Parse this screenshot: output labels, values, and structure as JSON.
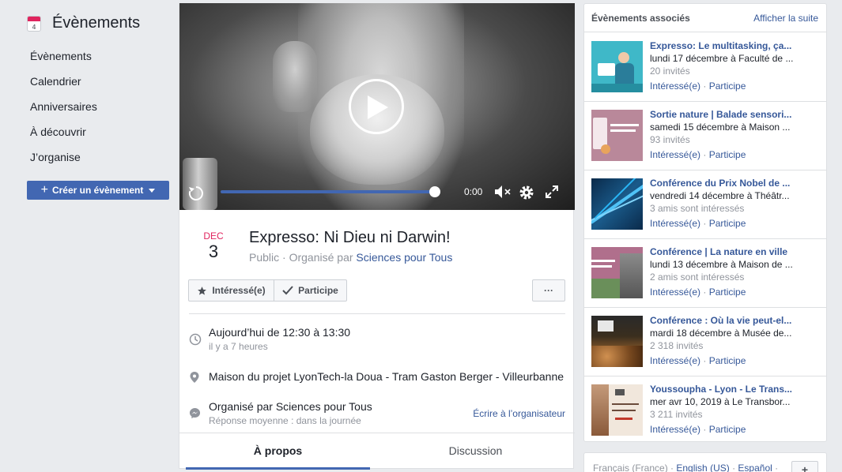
{
  "sidebar": {
    "icon_day": "4",
    "title": "Évènements",
    "items": [
      {
        "label": "Évènements"
      },
      {
        "label": "Calendrier"
      },
      {
        "label": "Anniversaires"
      },
      {
        "label": "À découvrir"
      },
      {
        "label": "J’organise"
      }
    ],
    "create_label": "Créer un évènement"
  },
  "video": {
    "time": "0:00"
  },
  "event": {
    "month": "DEC",
    "day": "3",
    "title": "Expresso: Ni Dieu ni Darwin!",
    "privacy": "Public",
    "organized_prefix": "· Organisé par",
    "organizer": "Sciences pour Tous",
    "interested_label": "Intéressé(e)",
    "participate_label": "Participe",
    "more_label": "···",
    "time_main": "Aujourd’hui de 12:30 à 13:30",
    "time_sub": "il y a 7 heures",
    "location": "Maison du projet LyonTech-la Doua - Tram Gaston Berger - Villeurbanne",
    "org_main": "Organisé par Sciences pour Tous",
    "org_sub": "Réponse moyenne : dans la journée",
    "org_link": "Écrire à l’organisateur"
  },
  "tabs": [
    {
      "label": "À propos"
    },
    {
      "label": "Discussion"
    }
  ],
  "related": {
    "title": "Évènements associés",
    "more": "Afficher la suite",
    "items": [
      {
        "title": "Expresso: Le multitasking, ça...",
        "date": "lundi 17 décembre à Faculté de ...",
        "count": "20 invités",
        "a1": "Intéressé(e)",
        "a2": "Participe"
      },
      {
        "title": "Sortie nature | Balade sensori...",
        "date": "samedi 15 décembre à Maison ...",
        "count": "93 invités",
        "a1": "Intéressé(e)",
        "a2": "Participe"
      },
      {
        "title": "Conférence du Prix Nobel de ...",
        "date": "vendredi 14 décembre à Théâtr...",
        "count": "3 amis sont intéressés",
        "a1": "Intéressé(e)",
        "a2": "Participe"
      },
      {
        "title": "Conférence | La nature en ville",
        "date": "lundi 13 décembre à Maison de ...",
        "count": "2 amis sont intéressés",
        "a1": "Intéressé(e)",
        "a2": "Participe"
      },
      {
        "title": "Conférence : Où la vie peut-el...",
        "date": "mardi 18 décembre à Musée de...",
        "count": "2 318 invités",
        "a1": "Intéressé(e)",
        "a2": "Participe"
      },
      {
        "title": "Youssoupha - Lyon - Le Trans...",
        "date": "mer avr 10, 2019 à Le Transbor...",
        "count": "3 211 invités",
        "a1": "Intéressé(e)",
        "a2": "Participe"
      }
    ]
  },
  "footer": {
    "current_lang": "Français (France)",
    "sep": "·",
    "lang1": "English (US)",
    "lang2": "Español",
    "plus": "+"
  }
}
